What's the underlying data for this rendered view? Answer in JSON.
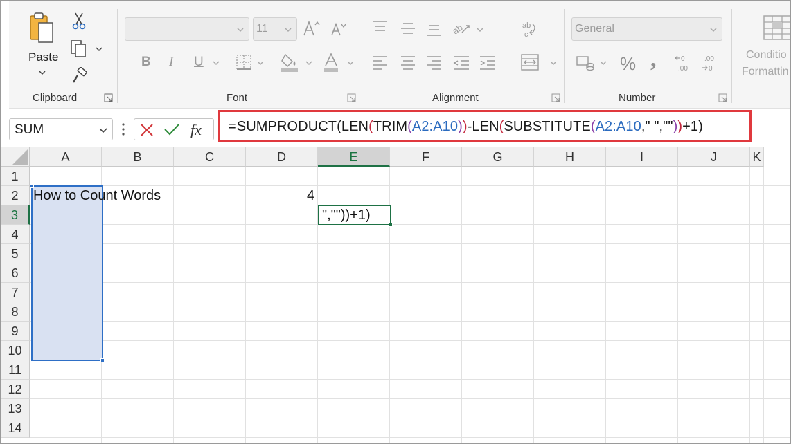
{
  "ribbon": {
    "clipboard": {
      "label": "Clipboard",
      "paste_label": "Paste"
    },
    "font": {
      "label": "Font",
      "font_name": "",
      "font_size": "11",
      "buttons": [
        "B",
        "I",
        "U"
      ]
    },
    "alignment": {
      "label": "Alignment"
    },
    "number": {
      "label": "Number",
      "format": "General",
      "percent": "%",
      "comma": ","
    },
    "styles": {
      "conditional_line1": "Conditio",
      "conditional_line2": "Formattin"
    }
  },
  "formula_bar": {
    "name_box": "SUM",
    "formula_parts": [
      {
        "text": "=SUMPRODUCT(LEN",
        "color": "#1a1a1a"
      },
      {
        "text": "(",
        "color": "#c5283d"
      },
      {
        "text": "TRIM",
        "color": "#1a1a1a"
      },
      {
        "text": "(",
        "color": "#8a3fa8"
      },
      {
        "text": "A2:A10",
        "color": "#2b6bbf"
      },
      {
        "text": ")",
        "color": "#8a3fa8"
      },
      {
        "text": ")",
        "color": "#c5283d"
      },
      {
        "text": "-LEN",
        "color": "#1a1a1a"
      },
      {
        "text": "(",
        "color": "#c5283d"
      },
      {
        "text": "SUBSTITUTE",
        "color": "#1a1a1a"
      },
      {
        "text": "(",
        "color": "#8a3fa8"
      },
      {
        "text": "A2:A10",
        "color": "#2b6bbf"
      },
      {
        "text": ",\" \",\"\"",
        "color": "#1a1a1a"
      },
      {
        "text": ")",
        "color": "#8a3fa8"
      },
      {
        "text": ")",
        "color": "#c5283d"
      },
      {
        "text": "+1)",
        "color": "#1a1a1a"
      }
    ],
    "highlight_color": "#e0393e"
  },
  "sheet": {
    "columns": [
      "A",
      "B",
      "C",
      "D",
      "E",
      "F",
      "G",
      "H",
      "I",
      "J",
      "K"
    ],
    "active_column": "E",
    "rows": [
      "1",
      "2",
      "3",
      "4",
      "5",
      "6",
      "7",
      "8",
      "9",
      "10",
      "11",
      "12",
      "13",
      "14"
    ],
    "active_row": "3",
    "cells": {
      "A2": "How to Count Words",
      "D2": "4",
      "E3": "\",\"\"))+1)"
    },
    "selected_range": "A2:A10",
    "active_cell": "E3",
    "selection_color": "#d9e1f2",
    "active_cell_color": "#1e7145"
  }
}
